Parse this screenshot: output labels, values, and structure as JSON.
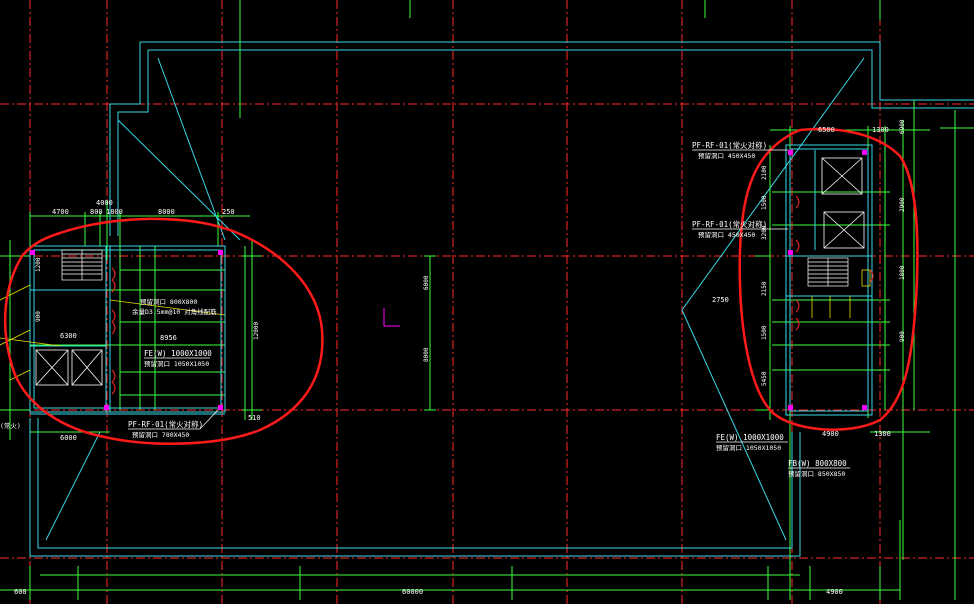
{
  "drawing": {
    "background": "#000000",
    "colors": {
      "axis_red": "#ff2a2a",
      "dim_green": "#3cff3c",
      "wall_cyan": "#38d8e6",
      "markup_red": "#ff1a1a",
      "hatch_yellow": "#e8e000",
      "text_white": "#ffffff",
      "magenta": "#ff00ff"
    }
  },
  "dimensions": {
    "top_left_4700": "4700",
    "top_left_800a": "800",
    "top_left_1800": "1800",
    "top_left_8000": "8000",
    "top_left_250": "250",
    "top_left_4000": "4000",
    "left_1200": "1200",
    "left_900": "900",
    "left_6300": "6300",
    "left_6000": "6000",
    "left_510": "510",
    "left_1200b": "12000",
    "mid_6000": "6000",
    "mid_8000": "8000",
    "bottom_60000": "60000",
    "bottom_600": "600",
    "bottom_4900": "4900",
    "bottom_1300": "1300",
    "right_6500": "6500",
    "right_1300": "1300",
    "right_6900": "6900",
    "right_2900": "2900",
    "right_2100": "2100",
    "right_1500": "1500",
    "right_3200": "3200",
    "right_2150": "2150",
    "right_1500b": "1500",
    "right_5450": "5450",
    "right_1800": "1800",
    "right_4900": "4900",
    "right_900": "900"
  },
  "labels": {
    "left_pf_top": "PF-RF-01(常火对称)",
    "left_pf_top_sub": "预留洞口 1050X1050",
    "left_dim_spec": "预留洞口 800X800",
    "left_spec2": "余量D3.5mm@10 对角线配筋",
    "left_fe": "FE(W) 1000X1000",
    "left_fe_sub": "预留洞口 1050X1050",
    "left_pf_bottom": "PF-RF-01(常火对称)",
    "left_pf_bottom_sub": "预留洞口 780X450",
    "left_small_6300": "6300",
    "left_small_8956": "8956",
    "right_pf_top": "PF-RF-01(常火对称)",
    "right_pf_top_sub": "预留洞口 450X450",
    "right_pf_mid": "PF-RF-01(常火对称)",
    "right_pf_mid_sub": "预留洞口 450X450",
    "right_fe": "FE(W) 1000X1000",
    "right_fe_sub": "预留洞口 1050X1050",
    "right_fb": "FB(W) 800X800",
    "right_fb_sub": "预留洞口 850X850",
    "mid_small": "2750",
    "left_edge_label": "(常火)"
  }
}
